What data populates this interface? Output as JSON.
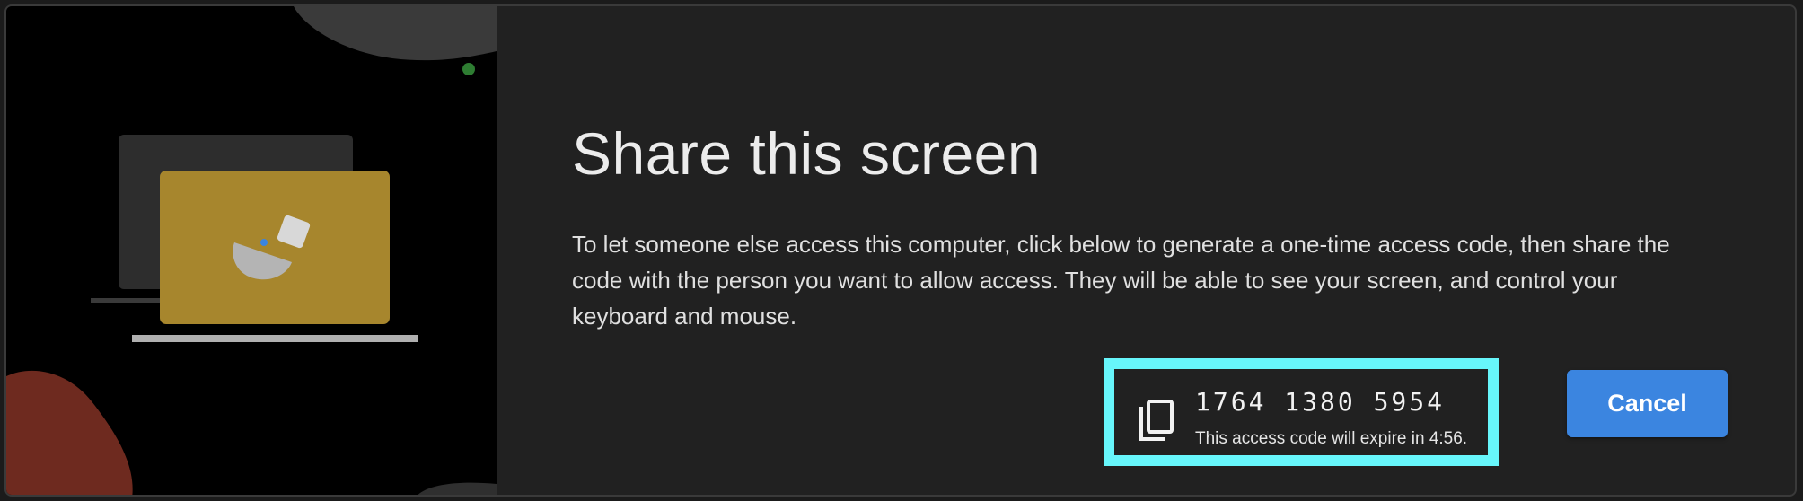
{
  "dialog": {
    "title": "Share this screen",
    "description": "To let someone else access this computer, click below to generate a one-time access code, then share the code with the person you want to allow access. They will be able to see your screen, and control your keyboard and mouse.",
    "access_code": "1764 1380 5954",
    "expiry_text": "This access code will expire in 4:56.",
    "cancel_label": "Cancel",
    "copy_icon": "copy-icon"
  },
  "colors": {
    "background": "#212121",
    "illustration_background": "#000000",
    "code_highlight_border": "#67f6fb",
    "cancel_button": "#3b85e0",
    "laptop_screen": "#a7862d"
  }
}
